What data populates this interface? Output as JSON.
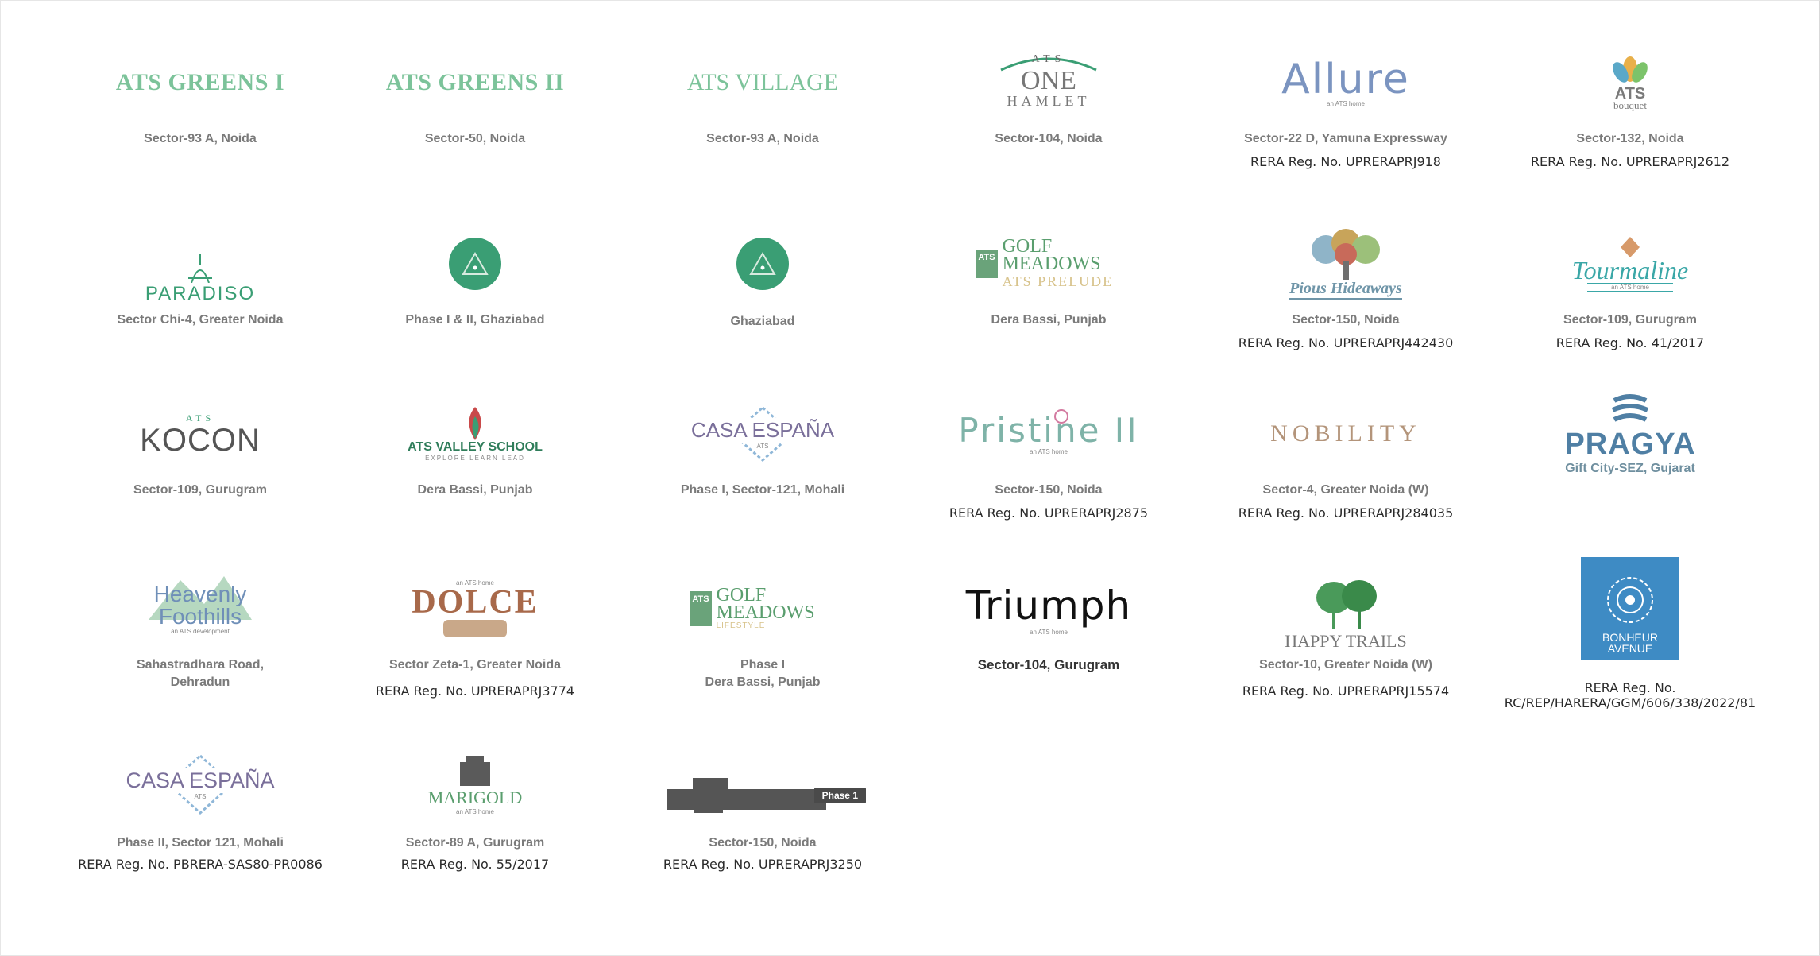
{
  "projects": [
    {
      "name": "ATS GREENS I",
      "location": "Sector-93 A, Noida",
      "rera": ""
    },
    {
      "name": "ATS GREENS II",
      "location": "Sector-50, Noida",
      "rera": ""
    },
    {
      "name": "ATS VILLAGE",
      "location": "Sector-93 A, Noida",
      "rera": ""
    },
    {
      "name": "ATS ONE HAMLET",
      "logo_top": "ATS",
      "logo_mid": "ONE",
      "logo_bottom": "HAMLET",
      "location": "Sector-104, Noida",
      "rera": ""
    },
    {
      "name": "Allure",
      "logo_sub": "an ATS home",
      "location": "Sector-22 D, Yamuna Expressway",
      "rera": "RERA Reg. No. UPRERAPRJ918"
    },
    {
      "name": "ATS",
      "logo_sub": "bouquet",
      "location": "Sector-132, Noida",
      "rera": "RERA Reg. No. UPRERAPRJ2612"
    },
    {
      "name": "PARADISO",
      "location": "Sector Chi-4, Greater Noida",
      "rera": ""
    },
    {
      "name": "",
      "location": "Phase I & II, Ghaziabad",
      "rera": ""
    },
    {
      "name": "",
      "location": "Ghaziabad",
      "rera": ""
    },
    {
      "name": "GOLF MEADOWS",
      "logo_top": "ATS",
      "logo_bottom": "ATS PRELUDE",
      "location": "Dera Bassi, Punjab",
      "rera": ""
    },
    {
      "name": "Pious Hideaways",
      "location": "Sector-150, Noida",
      "rera": "RERA Reg. No. UPRERAPRJ442430"
    },
    {
      "name": "Tourmaline",
      "logo_sub": "an ATS home",
      "location": "Sector-109, Gurugram",
      "rera": "RERA Reg. No. 41/2017"
    },
    {
      "name": "KOCON",
      "logo_top": "ATS",
      "location": "Sector-109, Gurugram",
      "rera": ""
    },
    {
      "name": "ATS VALLEY SCHOOL",
      "logo_sub": "EXPLORE LEARN LEAD",
      "location": "Dera Bassi, Punjab",
      "rera": ""
    },
    {
      "name": "CASA ESPAÑA",
      "logo_sub": "ATS",
      "location": "Phase I, Sector-121, Mohali",
      "rera": ""
    },
    {
      "name": "Pristine II",
      "logo_sub": "an ATS home",
      "location": "Sector-150, Noida",
      "rera": "RERA Reg. No. UPRERAPRJ2875"
    },
    {
      "name": "NOBILITY",
      "location": "Sector-4, Greater Noida (W)",
      "rera": "RERA Reg. No. UPRERAPRJ284035"
    },
    {
      "name": "PRAGYA",
      "location": "Gift City-SEZ, Gujarat",
      "rera": ""
    },
    {
      "name": "Heavenly Foothills",
      "logo_sub": "an ATS development",
      "location": "Sahastradhara Road,\nDehradun",
      "rera": ""
    },
    {
      "name": "DOLCE",
      "logo_top": "an ATS home",
      "location": "Sector Zeta-1, Greater Noida",
      "rera": "RERA Reg. No. UPRERAPRJ3774"
    },
    {
      "name": "GOLF MEADOWS",
      "logo_top": "ATS",
      "logo_bottom": "LIFESTYLE",
      "location": "Phase I\nDera Bassi, Punjab",
      "rera": ""
    },
    {
      "name": "Triumph",
      "logo_sub": "an ATS home",
      "location": "Sector-104, Gurugram",
      "rera": ""
    },
    {
      "name": "HAPPY TRAILS",
      "location": "Sector-10, Greater Noida (W)",
      "rera": "RERA Reg. No. UPRERAPRJ15574"
    },
    {
      "name": "BONHEUR AVENUE",
      "location": "",
      "rera": "RERA Reg. No.\nRC/REP/HARERA/GGM/606/338/2022/81"
    },
    {
      "name": "CASA ESPAÑA",
      "logo_sub": "ATS",
      "location": "Phase II, Sector 121, Mohali",
      "rera": "RERA Reg. No. PBRERA-SAS80-PR0086"
    },
    {
      "name": "MARIGOLD",
      "logo_sub": "an ATS home",
      "location": "Sector-89 A, Gurugram",
      "rera": "RERA Reg. No. 55/2017"
    },
    {
      "name": "Phase 1",
      "location": "Sector-150, Noida",
      "rera": "RERA Reg. No. UPRERAPRJ3250"
    }
  ],
  "colors": {
    "ats_green": "#7cc39a",
    "circle_green": "#3a9e74",
    "pragya_blue": "#4f7fa4",
    "bonheur_blue": "#3e8bc4",
    "location_gray": "#7a7a7a",
    "rera_text": "#2a2a2a"
  }
}
